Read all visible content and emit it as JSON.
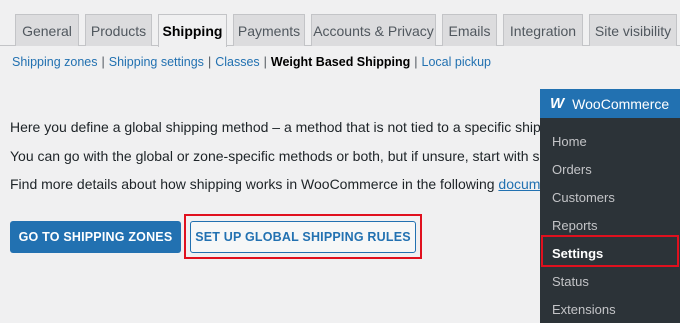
{
  "tabs": [
    {
      "label": "General"
    },
    {
      "label": "Products"
    },
    {
      "label": "Shipping"
    },
    {
      "label": "Payments"
    },
    {
      "label": "Accounts & Privacy"
    },
    {
      "label": "Emails"
    },
    {
      "label": "Integration"
    },
    {
      "label": "Site visibility"
    }
  ],
  "active_tab": "Shipping",
  "subnav": {
    "zones": "Shipping zones",
    "settings": "Shipping settings",
    "classes": "Classes",
    "weight": "Weight Based Shipping",
    "local": "Local pickup",
    "separator": "|"
  },
  "content": {
    "p1": "Here you define a global shipping method – a method that is not tied to a specific shipping",
    "p2": "You can go with the global or zone-specific methods or both, but if unsure, start with shippi",
    "p3_text": "Find more details about how shipping works in WooCommerce in the following ",
    "p3_link": "documentat"
  },
  "buttons": {
    "zones": "GO TO SHIPPING ZONES",
    "global": "SET UP GLOBAL SHIPPING RULES"
  },
  "admin_menu": {
    "title": "WooCommerce",
    "logo": "W",
    "items": [
      "Home",
      "Orders",
      "Customers",
      "Reports",
      "Settings",
      "Status",
      "Extensions"
    ],
    "current": "Settings"
  },
  "colors": {
    "accent": "#2271b1",
    "highlight": "#e0101e",
    "menu_bg": "#2c3338"
  }
}
